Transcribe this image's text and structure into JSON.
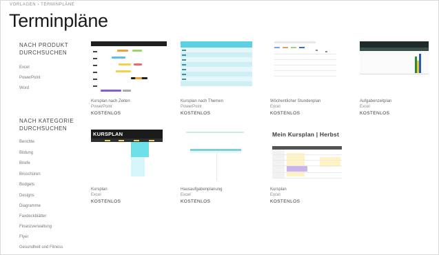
{
  "breadcrumb": "VORLAGEN  ›  TERMINPLÄNE",
  "page_title": "Terminpläne",
  "sidebar": {
    "product_section_line1": "NACH PRODUKT",
    "product_section_line2": "DURCHSUCHEN",
    "products": [
      "Excel",
      "PowerPoint",
      "Word"
    ],
    "category_section_line1": "NACH KATEGORIE",
    "category_section_line2": "DURCHSUCHEN",
    "categories": [
      "Berichte",
      "Bildung",
      "Briefe",
      "Broschüren",
      "Budgets",
      "Designs",
      "Diagramme",
      "Faxdeckblätter",
      "Finanzverwaltung",
      "Flyer",
      "Gesundheit und Fitness"
    ]
  },
  "cards": [
    {
      "title": "Kursplan nach Zeiten",
      "app": "PowerPoint",
      "price": "KOSTENLOS"
    },
    {
      "title": "Kursplan nach Themen",
      "app": "PowerPoint",
      "price": "KOSTENLOS"
    },
    {
      "title": "Wöchentlicher Stundenplan",
      "app": "Excel",
      "price": "KOSTENLOS"
    },
    {
      "title": "Aufgabenzeitplan",
      "app": "Excel",
      "price": "KOSTENLOS"
    },
    {
      "title": "Kursplan",
      "app": "Excel",
      "price": "KOSTENLOS"
    },
    {
      "title": "Hausaufgabenplanung",
      "app": "Excel",
      "price": "KOSTENLOS"
    },
    {
      "title": "Kursplan",
      "app": "Excel",
      "price": "KOSTENLOS"
    }
  ],
  "thumbnails": {
    "kursplan_header": "KURSPLAN",
    "mein_kursplan_header": "Mein Kursplan | Herbst"
  },
  "colors": {
    "accent_cyan": "#5ad0e0",
    "dark_header": "#1f1f1f",
    "purple_block": "#8a5ad0",
    "yellow_block": "#fff3c4"
  }
}
